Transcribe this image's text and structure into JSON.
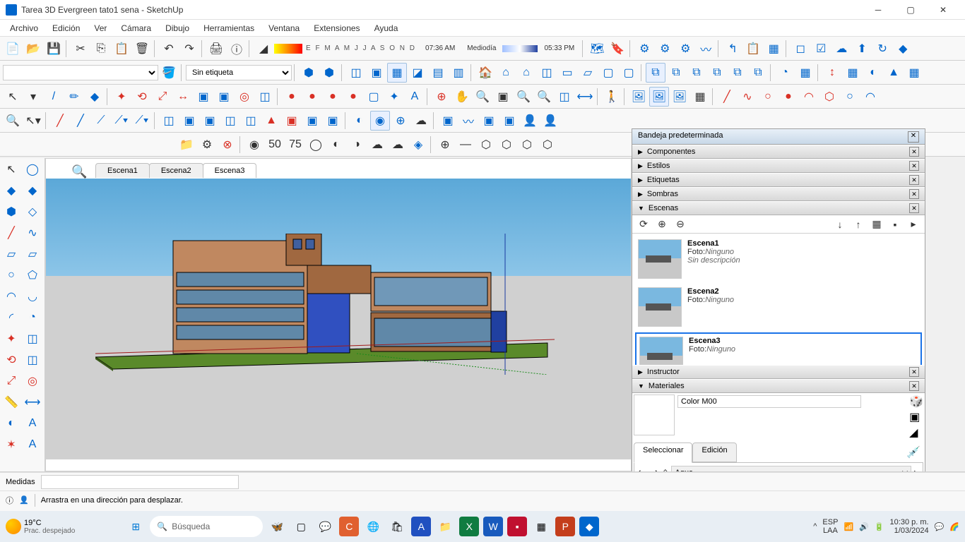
{
  "titlebar": {
    "title": "Tarea 3D Evergreen tato1 sena - SketchUp"
  },
  "menu": [
    "Archivo",
    "Edición",
    "Ver",
    "Cámara",
    "Dibujo",
    "Herramientas",
    "Ventana",
    "Extensiones",
    "Ayuda"
  ],
  "time": {
    "am": "07:36 AM",
    "mid": "Mediodía",
    "pm": "05:33 PM"
  },
  "months": "E F M A M J J A S O N D",
  "tags": {
    "label": "Sin etiqueta"
  },
  "scene_tabs": [
    "Escena1",
    "Escena2",
    "Escena3"
  ],
  "active_scene_tab": 2,
  "tray": {
    "title": "Bandeja predeterminada",
    "panels": [
      "Componentes",
      "Estilos",
      "Etiquetas",
      "Sombras",
      "Escenas",
      "Instructor",
      "Materiales"
    ],
    "scenes": [
      {
        "name": "Escena1",
        "foto_label": "Foto:",
        "foto": "Ninguno",
        "desc": "Sin descripción"
      },
      {
        "name": "Escena2",
        "foto_label": "Foto:",
        "foto": "Ninguno",
        "desc": ""
      },
      {
        "name": "Escena3",
        "foto_label": "Foto:",
        "foto": "Ninguno",
        "desc": ""
      }
    ],
    "materials": {
      "name": "Color M00",
      "tab_sel": "Seleccionar",
      "tab_edit": "Edición",
      "library": "Agua"
    }
  },
  "status": {
    "medidas_label": "Medidas",
    "hint": "Arrastra en una dirección para desplazar."
  },
  "taskbar": {
    "temp": "19°C",
    "cond": "Prac. despejado",
    "search": "Búsqueda",
    "lang1": "ESP",
    "lang2": "LAA",
    "time": "10:30 p. m.",
    "date": "1/03/2024"
  }
}
